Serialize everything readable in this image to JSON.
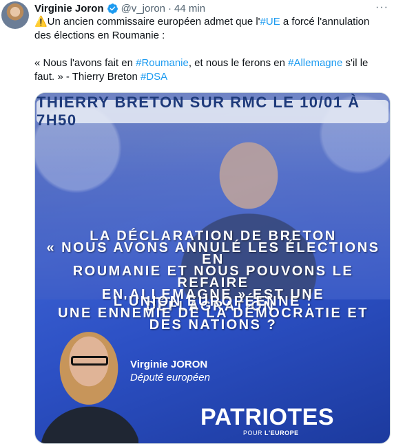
{
  "author": {
    "name": "Virginie Joron",
    "handle": "@v_joron",
    "separator": "·",
    "time": "44 min",
    "more_label": "···"
  },
  "tweet": {
    "line1_prefix": "⚠️Un ancien commissaire européen admet que l'",
    "tag_ue": "#UE",
    "line1_suffix": " a forcé l'annulation des élections en Roumanie :",
    "line2_prefix": "« Nous l'avons fait en ",
    "tag_roumanie": "#Roumanie",
    "line2_mid": ", et nous le ferons en ",
    "tag_allemagne": "#Allemagne",
    "line2_suffix": " s'il le faut. » - Thierry Breton ",
    "tag_dsa": "#DSA"
  },
  "media": {
    "banner": "THIERRY BRETON SUR RMC LE 10/01 À 7H50",
    "quote_lines": [
      "LA DÉCLARATION DE BRETON",
      "« NOUS AVONS ANNULÉ LES ÉLECTIONS EN",
      "ROUMANIE ET NOUS POUVONS LE REFAIRE",
      "EN ALLEMAGNE » EST UNE DÉFLAGRATION."
    ],
    "quote2_lines": [
      "L'UNION EUROPÉENNE :",
      "UNE ENNEMIE DE LA DÉMOCRATIE ET",
      "DES NATIONS ?"
    ],
    "person_name": "Virginie JORON",
    "person_role": "Député européen",
    "logo_main": "PATRIOTES",
    "logo_sub_a": "POUR ",
    "logo_sub_b": "L'EUROPE"
  },
  "colors": {
    "link": "#1d9bf0",
    "verified": "#1d9bf0",
    "muted": "#536471"
  }
}
